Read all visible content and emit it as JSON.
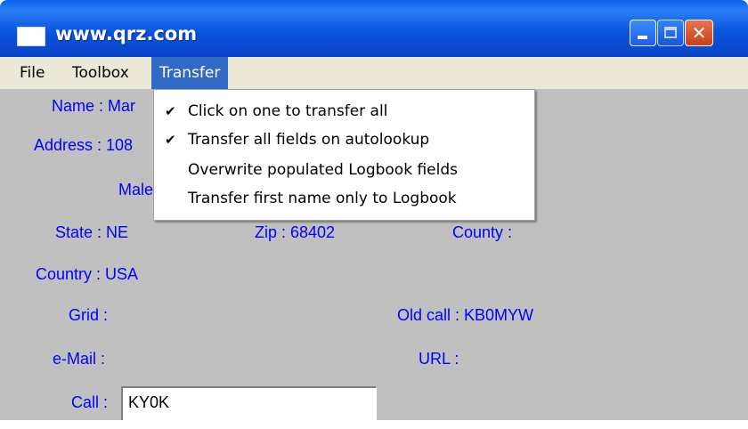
{
  "window": {
    "title": "www.qrz.com",
    "controls": {
      "minimize": "minimize",
      "maximize": "maximize",
      "close": "✕"
    }
  },
  "menubar": {
    "items": [
      {
        "label": "File"
      },
      {
        "label": "Toolbox"
      },
      {
        "label": "Transfer",
        "active": true
      }
    ]
  },
  "transfer_menu": {
    "items": [
      {
        "label": "Click on one to transfer all",
        "checked": true,
        "check": "✔"
      },
      {
        "label": "Transfer all fields on autolookup",
        "checked": true,
        "check": "✔"
      },
      {
        "label": "Overwrite populated Logbook fields",
        "checked": false,
        "check": ""
      },
      {
        "label": "Transfer first name only to Logbook",
        "checked": false,
        "check": ""
      }
    ]
  },
  "form": {
    "name": "Name : Mar",
    "address": "Address : 108",
    "male": "Male",
    "state": "State : NE",
    "zip": "Zip : 68402",
    "county": "County :",
    "country": "Country : USA",
    "grid": "Grid :",
    "old_call": "Old call : KB0MYW",
    "email": "e-Mail :",
    "url": "URL :",
    "call_label": "Call :",
    "call_value": "KY0K"
  },
  "colors": {
    "title_bar": "#0a55dd",
    "menu_highlight": "#316ac5",
    "client_bg": "#c0c0c0",
    "label_text": "#0000ff"
  }
}
